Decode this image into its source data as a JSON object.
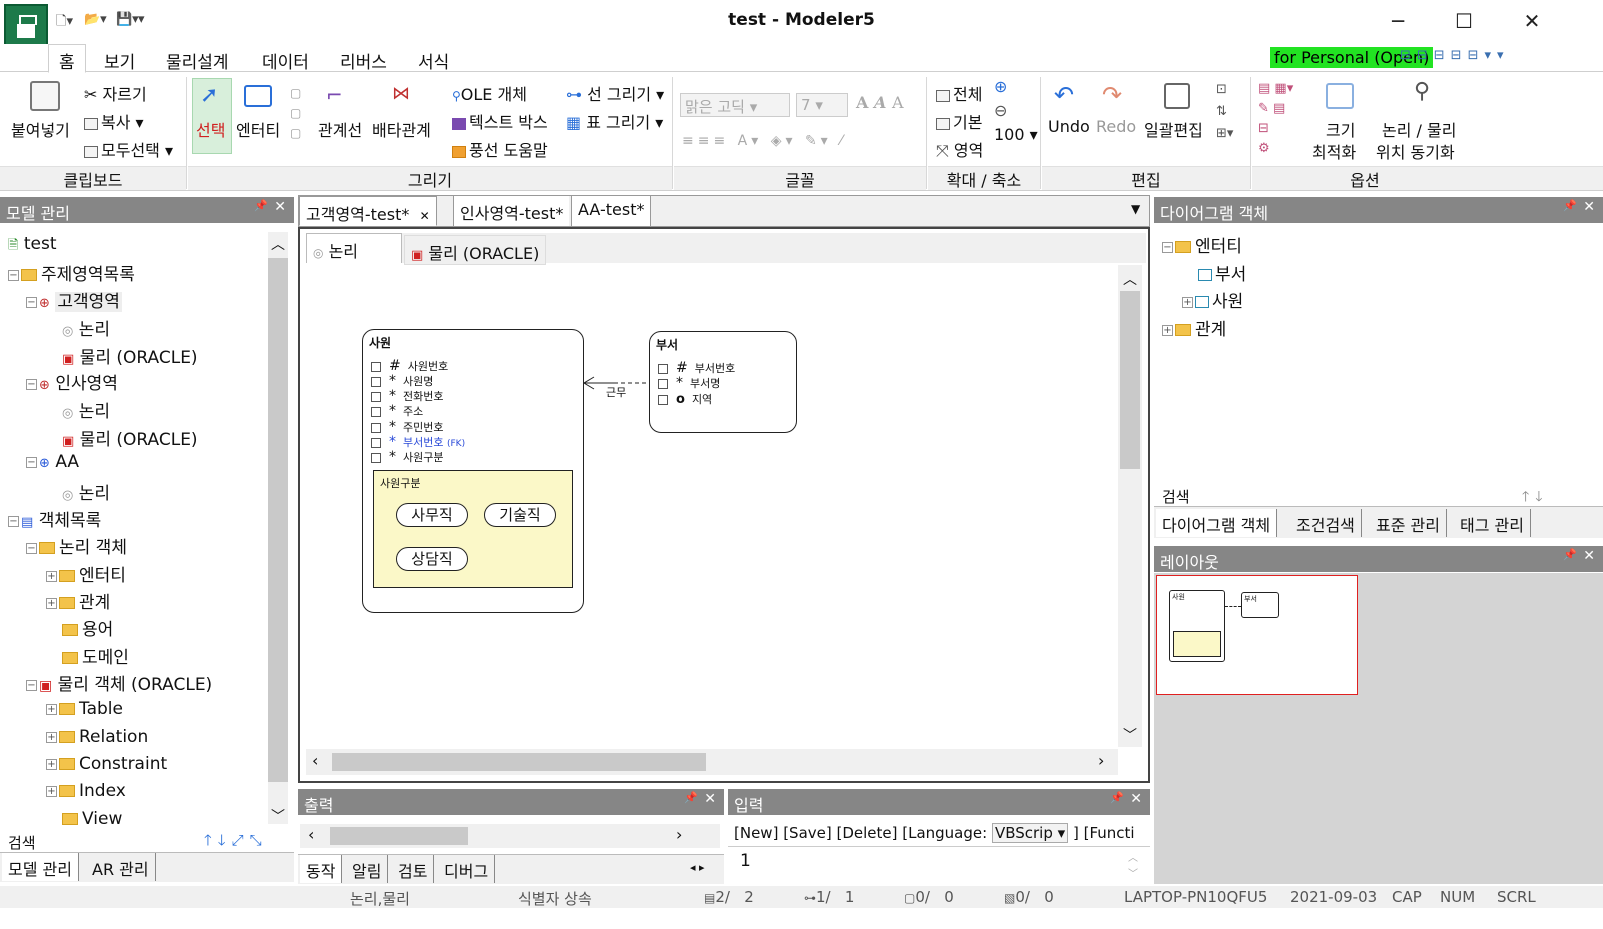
{
  "window": {
    "title": "test - Modeler5",
    "minimize": "─",
    "maximize": "☐",
    "close": "✕"
  },
  "menu": {
    "items": [
      "홈",
      "보기",
      "물리설계",
      "데이터",
      "리버스",
      "서식"
    ],
    "badge": "for Personal (Open)"
  },
  "ribbon": {
    "clipboard": {
      "paste": "붙여넣기",
      "cut": "자르기",
      "copy": "복사",
      "select_all": "모두선택",
      "label": "클립보드"
    },
    "draw": {
      "select": "선택",
      "entity": "엔터티",
      "relation": "관계선",
      "exclusive": "배타관계",
      "ole": "OLE 개체",
      "textbox": "텍스트 박스",
      "balloon": "풍선 도움말",
      "line": "선 그리기",
      "table": "표 그리기",
      "label": "그리기"
    },
    "font": {
      "name": "맑은 고딕",
      "size": "7",
      "label": "글꼴"
    },
    "zoom": {
      "all": "전체",
      "default": "기본",
      "area": "영역",
      "value": "100",
      "label": "확대 / 축소"
    },
    "edit": {
      "undo": "Undo",
      "redo": "Redo",
      "bulk": "일괄편집",
      "label": "편집"
    },
    "options": {
      "fit_line1": "크기",
      "fit_line2": "최적화",
      "sync_line1": "논리 / 물리",
      "sync_line2": "위치 동기화",
      "label": "옵션"
    }
  },
  "model_panel": {
    "title": "모델 관리",
    "tree": [
      "test",
      "주제영역목록",
      "고객영역",
      "논리",
      "물리 (ORACLE)",
      "인사영역",
      "논리",
      "물리 (ORACLE)",
      "AA",
      "논리",
      "객체목록",
      "논리 객체",
      "엔터티",
      "관계",
      "용어",
      "도메인",
      "물리 객체 (ORACLE)",
      "Table",
      "Relation",
      "Constraint",
      "Index",
      "View"
    ],
    "search_label": "검색",
    "tabs": [
      "모델 관리",
      "AR 관리"
    ]
  },
  "doc_tabs": [
    "고객영역-test*",
    "인사영역-test*",
    "AA-test*"
  ],
  "view_tabs": [
    "논리",
    "물리 (ORACLE)"
  ],
  "diagram": {
    "entity1": {
      "name": "사원",
      "attrs": [
        {
          "mark": "#",
          "name": "사원번호"
        },
        {
          "mark": "*",
          "name": "사원명"
        },
        {
          "mark": "*",
          "name": "전화번호"
        },
        {
          "mark": "*",
          "name": "주소"
        },
        {
          "mark": "*",
          "name": "주민번호"
        },
        {
          "mark": "*",
          "name": "부서번호",
          "fk": "(FK)"
        },
        {
          "mark": "*",
          "name": "사원구분"
        }
      ],
      "subtype_title": "사원구분",
      "subtypes": [
        "사무직",
        "기술직",
        "상담직"
      ]
    },
    "relationship": "근무",
    "entity2": {
      "name": "부서",
      "attrs": [
        {
          "mark": "#",
          "name": "부서번호"
        },
        {
          "mark": "*",
          "name": "부서명"
        },
        {
          "mark": "o",
          "name": "지역"
        }
      ]
    }
  },
  "output_panel": {
    "title": "출력",
    "tabs": [
      "동작",
      "알림",
      "검토",
      "디버그"
    ]
  },
  "input_panel": {
    "title": "입력",
    "toolbar": "[New]  [Save]  [Delete]    [Language:",
    "language": "VBScrip",
    "func": "]  [Functi",
    "line": "1"
  },
  "diagram_objects": {
    "title": "다이어그램 객체",
    "tree": [
      "엔터티",
      "부서",
      "사원",
      "관계"
    ],
    "search_label": "검색",
    "tabs": [
      "다이어그램 객체",
      "조건검색",
      "표준 관리",
      "태그 관리"
    ]
  },
  "layout_panel": {
    "title": "레이아웃",
    "mini_e1": "사원",
    "mini_e2": "부서"
  },
  "status": {
    "mode": "논리,물리",
    "ident": "식별자 상속",
    "count1": "2/",
    "count1b": "2",
    "count2": "1/",
    "count2b": "1",
    "count3": "0/",
    "count3b": "0",
    "count4": "0/",
    "count4b": "0",
    "host": "LAPTOP-PN10QFU5",
    "date": "2021-09-03",
    "cap": "CAP",
    "num": "NUM",
    "scrl": "SCRL"
  }
}
